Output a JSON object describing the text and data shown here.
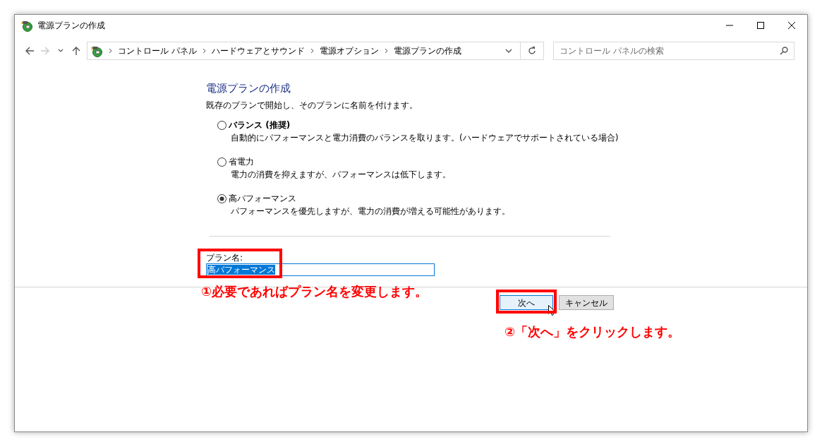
{
  "window": {
    "title": "電源プランの作成"
  },
  "nav": [
    {
      "kind": "back",
      "disabled": false
    },
    {
      "kind": "forward",
      "disabled": true
    },
    {
      "kind": "recent",
      "disabled": false
    },
    {
      "kind": "up",
      "disabled": false
    }
  ],
  "address_bar": {
    "breadcrumbs": [
      "コントロール パネル",
      "ハードウェアとサウンド",
      "電源オプション",
      "電源プランの作成"
    ]
  },
  "search": {
    "placeholder": "コントロール パネルの検索"
  },
  "heading": "電源プランの作成",
  "intro": "既存のプランで開始し、そのプランに名前を付けます。",
  "plans": [
    {
      "name": "バランス (推奨)",
      "description": "自動的にパフォーマンスと電力消費のバランスを取ります。(ハードウェアでサポートされている場合)",
      "selected": false,
      "bold": true
    },
    {
      "name": "省電力",
      "description": "電力の消費を抑えますが、パフォーマンスは低下します。",
      "selected": false,
      "bold": false
    },
    {
      "name": "高パフォーマンス",
      "description": "パフォーマンスを優先しますが、電力の消費が増える可能性があります。",
      "selected": true,
      "bold": false
    }
  ],
  "plan_name": {
    "label": "プラン名:",
    "value": "高パフォーマンス"
  },
  "buttons": [
    {
      "label": "次へ",
      "kind": "default"
    },
    {
      "label": "キャンセル",
      "kind": "normal"
    }
  ],
  "annotations": [
    {
      "text": "①必要であればプラン名を変更します。",
      "kind": "field"
    },
    {
      "text": "②「次へ」をクリックします。",
      "kind": "button"
    }
  ]
}
